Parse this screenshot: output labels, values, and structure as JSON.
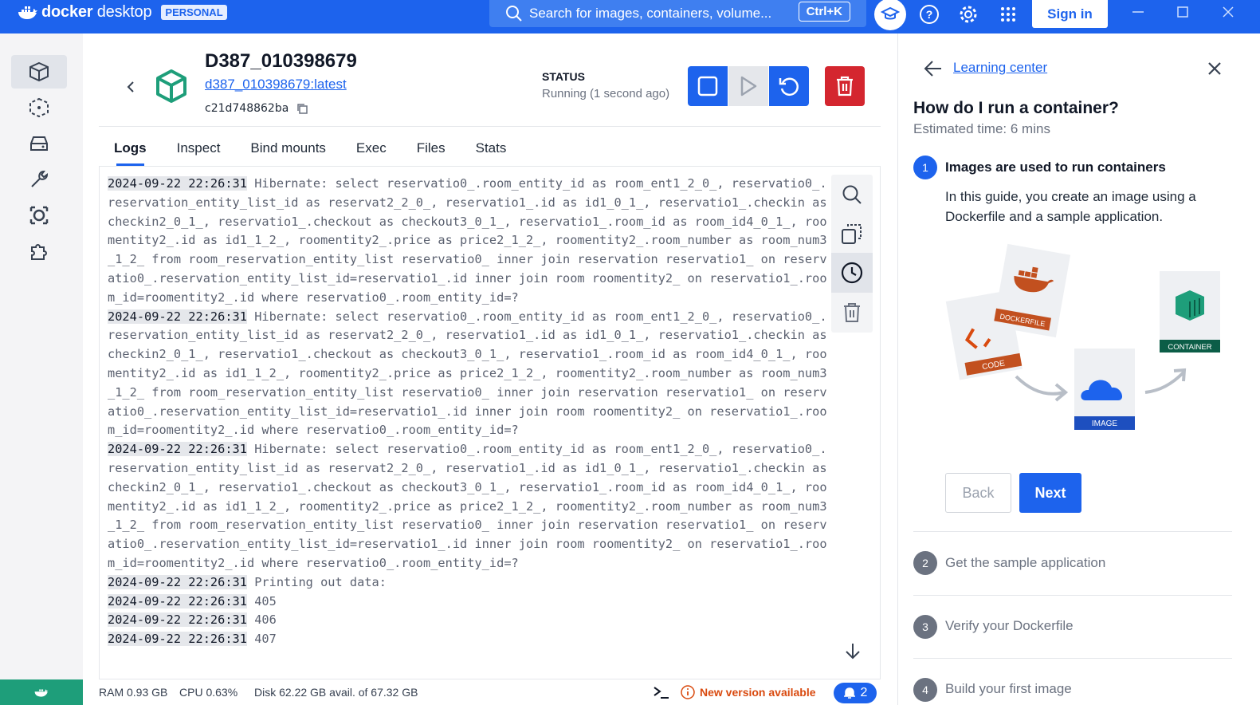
{
  "topbar": {
    "brand": "docker desktop",
    "brand_bold": "docker",
    "brand_light": "desktop",
    "plan_badge": "PERSONAL",
    "search_placeholder": "Search for images, containers, volume...",
    "search_shortcut": "Ctrl+K",
    "signin_label": "Sign in",
    "accent": "#1d63ed"
  },
  "sidebar": {
    "items": [
      {
        "icon": "containers-icon",
        "active": true
      },
      {
        "icon": "images-icon"
      },
      {
        "icon": "volumes-icon"
      },
      {
        "icon": "dev-environments-icon"
      },
      {
        "icon": "docker-scout-icon"
      },
      {
        "icon": "extensions-icon"
      }
    ]
  },
  "container": {
    "name": "D387_010398679",
    "image": "d387_010398679:latest",
    "id": "c21d748862ba",
    "status_label": "STATUS",
    "status_value": "Running (1 second ago)"
  },
  "tabs": [
    {
      "label": "Logs",
      "active": true
    },
    {
      "label": "Inspect"
    },
    {
      "label": "Bind mounts"
    },
    {
      "label": "Exec"
    },
    {
      "label": "Files"
    },
    {
      "label": "Stats"
    }
  ],
  "logs": [
    {
      "ts": "2024-09-22 22:26:31",
      "msg": " Hibernate: select reservatio0_.room_entity_id as room_ent1_2_0_, reservatio0_.reservation_entity_list_id as reservat2_2_0_, reservatio1_.id as id1_0_1_, reservatio1_.checkin as checkin2_0_1_, reservatio1_.checkout as checkout3_0_1_, reservatio1_.room_id as room_id4_0_1_, roomentity2_.id as id1_1_2_, roomentity2_.price as price2_1_2_, roomentity2_.room_number as room_num3_1_2_ from room_reservation_entity_list reservatio0_ inner join reservation reservatio1_ on reservatio0_.reservation_entity_list_id=reservatio1_.id inner join room roomentity2_ on reservatio1_.room_id=roomentity2_.id where reservatio0_.room_entity_id=?"
    },
    {
      "ts": "2024-09-22 22:26:31",
      "msg": " Hibernate: select reservatio0_.room_entity_id as room_ent1_2_0_, reservatio0_.reservation_entity_list_id as reservat2_2_0_, reservatio1_.id as id1_0_1_, reservatio1_.checkin as checkin2_0_1_, reservatio1_.checkout as checkout3_0_1_, reservatio1_.room_id as room_id4_0_1_, roomentity2_.id as id1_1_2_, roomentity2_.price as price2_1_2_, roomentity2_.room_number as room_num3_1_2_ from room_reservation_entity_list reservatio0_ inner join reservation reservatio1_ on reservatio0_.reservation_entity_list_id=reservatio1_.id inner join room roomentity2_ on reservatio1_.room_id=roomentity2_.id where reservatio0_.room_entity_id=?"
    },
    {
      "ts": "2024-09-22 22:26:31",
      "msg": " Hibernate: select reservatio0_.room_entity_id as room_ent1_2_0_, reservatio0_.reservation_entity_list_id as reservat2_2_0_, reservatio1_.id as id1_0_1_, reservatio1_.checkin as checkin2_0_1_, reservatio1_.checkout as checkout3_0_1_, reservatio1_.room_id as room_id4_0_1_, roomentity2_.id as id1_1_2_, roomentity2_.price as price2_1_2_, roomentity2_.room_number as room_num3_1_2_ from room_reservation_entity_list reservatio0_ inner join reservation reservatio1_ on reservatio0_.reservation_entity_list_id=reservatio1_.id inner join room roomentity2_ on reservatio1_.room_id=roomentity2_.id where reservatio0_.room_entity_id=?"
    },
    {
      "ts": "2024-09-22 22:26:31",
      "msg": " Printing out data:"
    },
    {
      "ts": "2024-09-22 22:26:31",
      "msg": " 405"
    },
    {
      "ts": "2024-09-22 22:26:31",
      "msg": " 406"
    },
    {
      "ts": "2024-09-22 22:26:31",
      "msg": " 407"
    }
  ],
  "footer": {
    "ram": "RAM 0.93 GB",
    "cpu": "CPU 0.63%",
    "disk": "Disk 62.22 GB avail. of 67.32 GB",
    "update": "New version available",
    "notifications": "2",
    "update_color": "#d94a0f"
  },
  "learning": {
    "back_link": "Learning center",
    "heading": "How do I run a container?",
    "estimate": "Estimated time: 6 mins",
    "steps": [
      {
        "num": "1",
        "title": "Images are used to run containers",
        "desc": "In this guide, you create an image using a Dockerfile and a sample application."
      },
      {
        "num": "2",
        "title": "Get the sample application"
      },
      {
        "num": "3",
        "title": "Verify your Dockerfile"
      },
      {
        "num": "4",
        "title": "Build your first image"
      }
    ],
    "illustration_labels": {
      "code": "CODE",
      "dockerfile": "DOCKERFILE",
      "image": "IMAGE",
      "container": "CONTAINER"
    },
    "back_label": "Back",
    "next_label": "Next"
  }
}
